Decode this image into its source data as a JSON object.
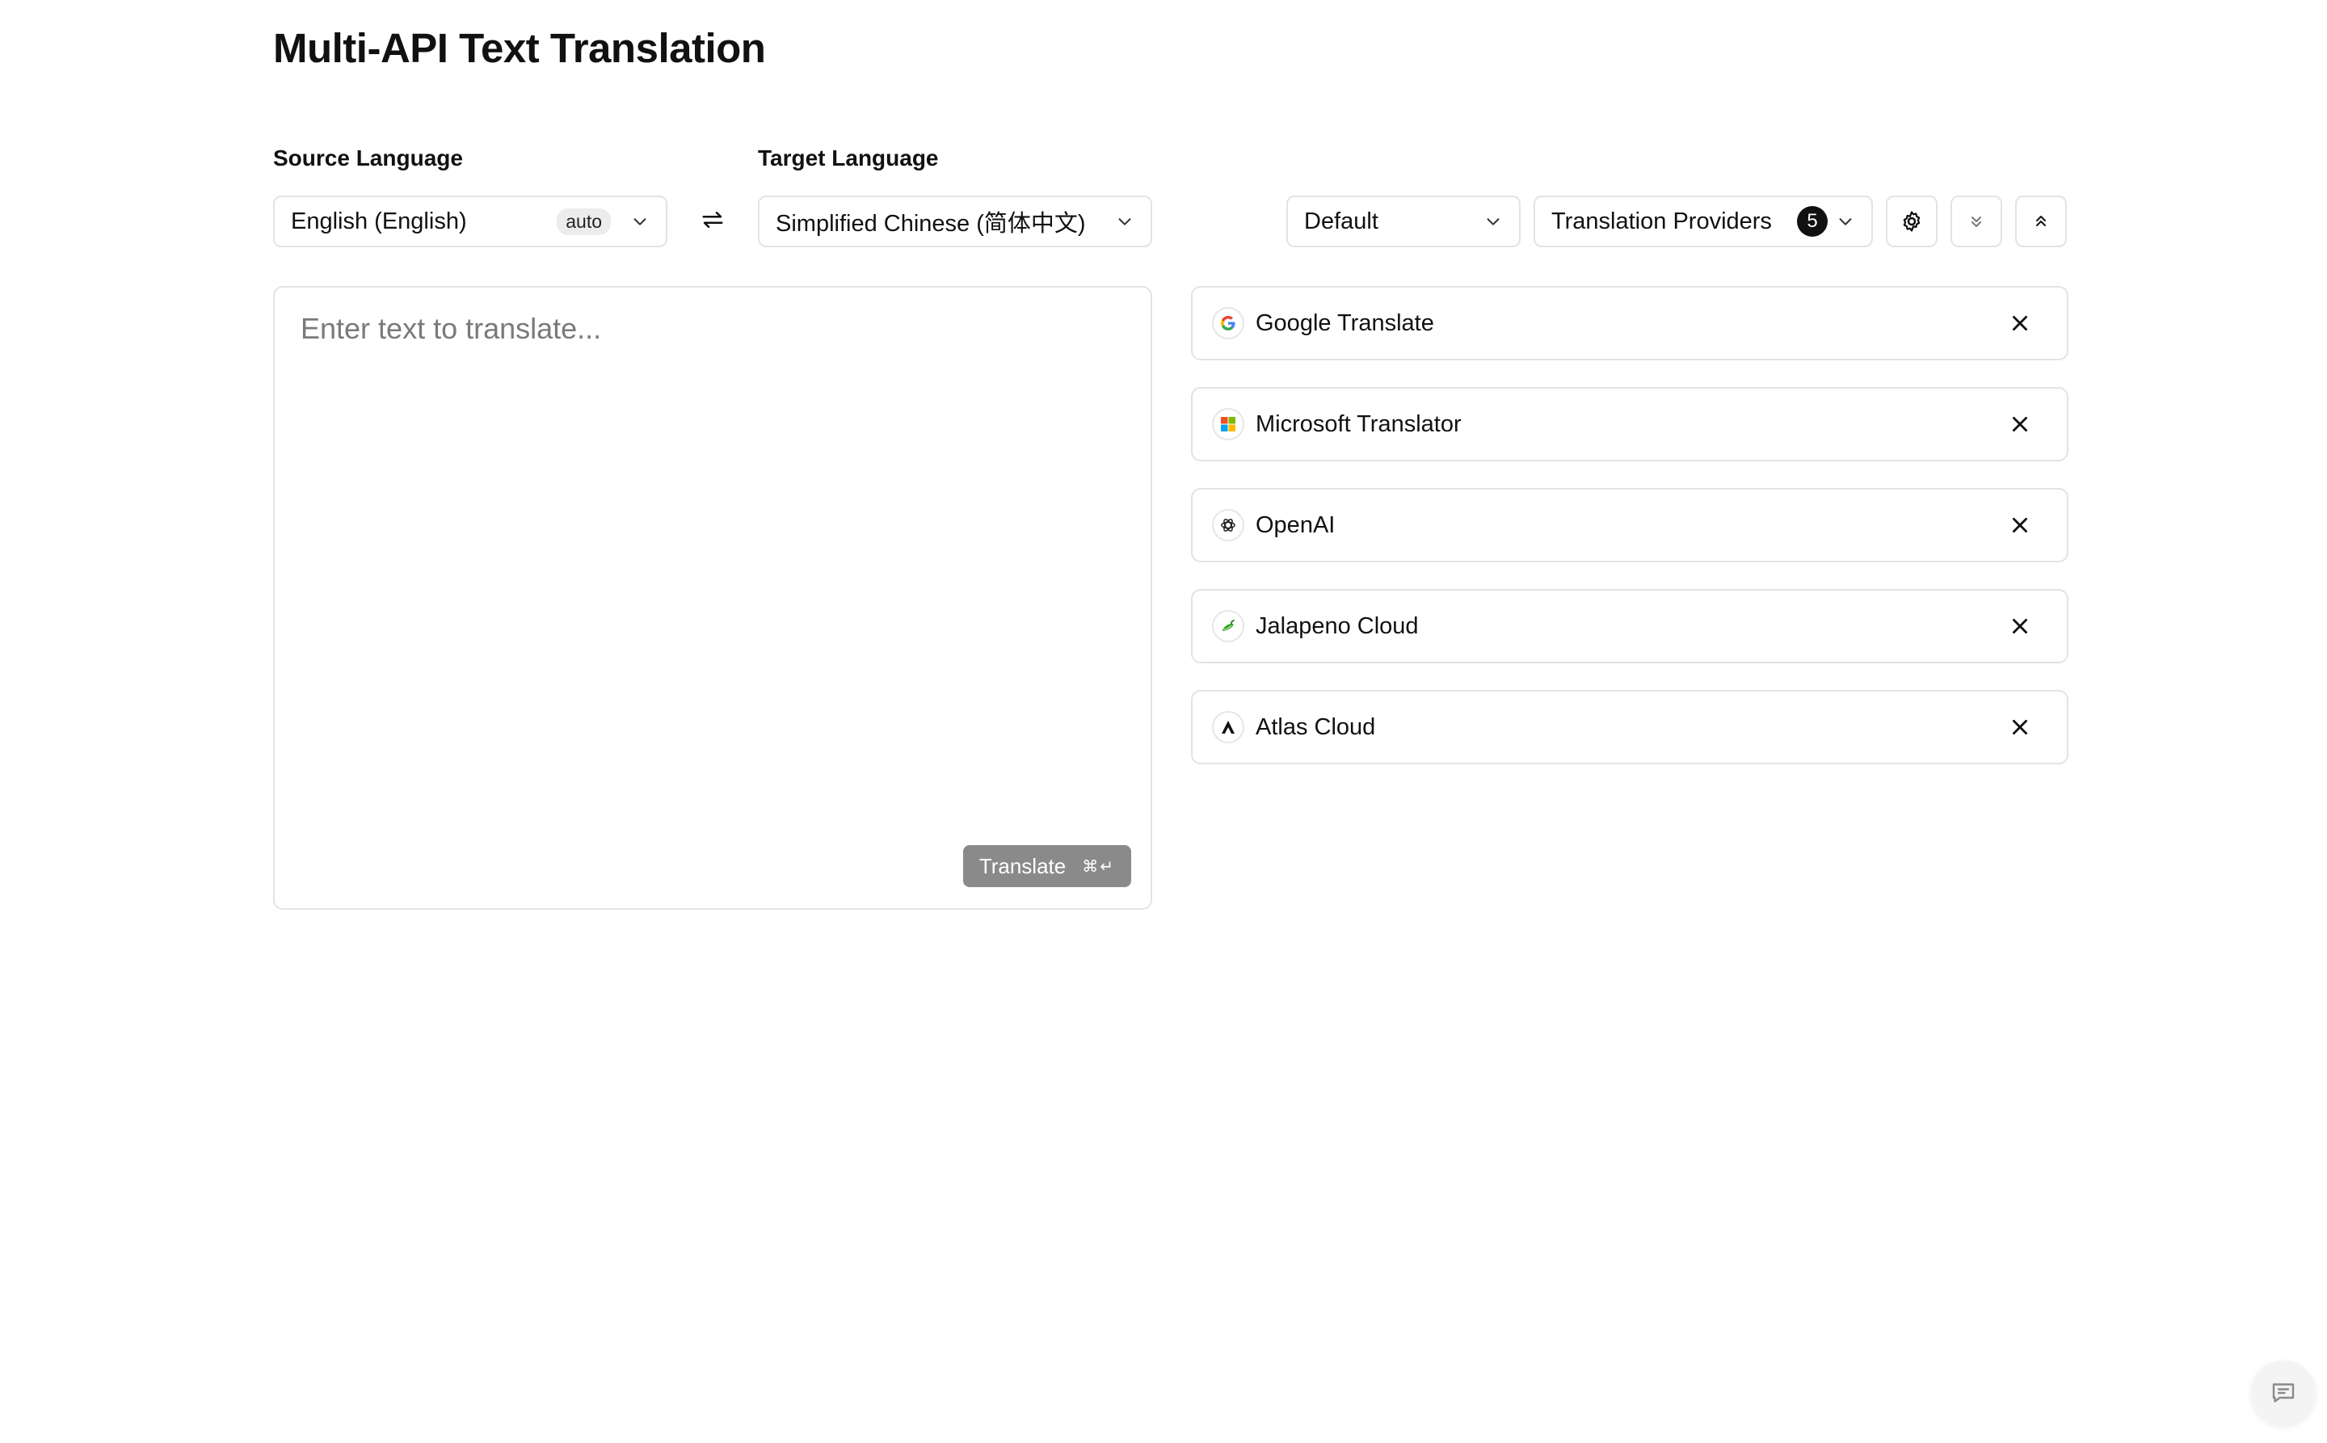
{
  "header": {
    "title": "Multi-API Text Translation"
  },
  "source": {
    "label": "Source Language",
    "selected": "English (English)",
    "auto_badge": "auto"
  },
  "target": {
    "label": "Target Language",
    "selected": "Simplified Chinese (简体中文)"
  },
  "controls": {
    "preset_selected": "Default",
    "providers_label": "Translation Providers",
    "providers_count": "5"
  },
  "input": {
    "placeholder": "Enter text to translate...",
    "value": ""
  },
  "translate_button": {
    "label": "Translate",
    "shortcut": "⌘↵"
  },
  "providers": [
    {
      "name": "Google Translate",
      "icon": "google-icon"
    },
    {
      "name": "Microsoft Translator",
      "icon": "microsoft-icon"
    },
    {
      "name": "OpenAI",
      "icon": "openai-icon"
    },
    {
      "name": "Jalapeno Cloud",
      "icon": "jalapeno-icon"
    },
    {
      "name": "Atlas Cloud",
      "icon": "atlas-icon"
    }
  ],
  "colors": {
    "accent": "#111111",
    "border": "#e3e3e3",
    "translate_button_bg": "#8a8a8a"
  }
}
